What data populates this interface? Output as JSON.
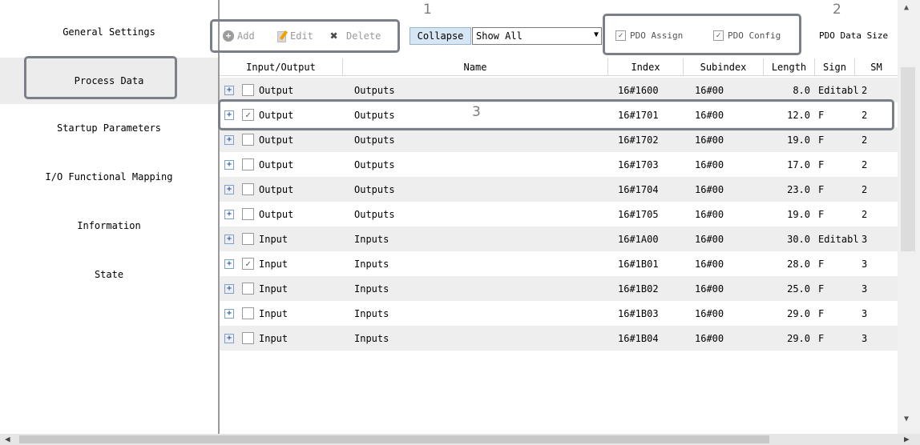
{
  "sidebar": {
    "items": [
      {
        "label": "General Settings"
      },
      {
        "label": "Process Data"
      },
      {
        "label": "Startup Parameters"
      },
      {
        "label": "I/O Functional Mapping"
      },
      {
        "label": "Information"
      },
      {
        "label": "State"
      }
    ]
  },
  "toolbar": {
    "add_label": "Add",
    "edit_label": "Edit",
    "delete_label": "Delete",
    "collapse_label": "Collapse",
    "filter_value": "Show All",
    "pdo_assign_label": "PDO Assign",
    "pdo_config_label": "PDO Config",
    "pdo_data_size_label": "PDO Data Size"
  },
  "annotations": {
    "one": "1",
    "two": "2",
    "three": "3"
  },
  "table": {
    "headers": [
      "Input/Output",
      "Name",
      "Index",
      "Subindex",
      "Length",
      "Sign",
      "SM"
    ],
    "rows": [
      {
        "io": "Output",
        "checked": false,
        "name": "Outputs",
        "index": "16#1600",
        "subindex": "16#00",
        "length": "8.0",
        "sign": "Editabl",
        "sm": "2"
      },
      {
        "io": "Output",
        "checked": true,
        "name": "Outputs",
        "index": "16#1701",
        "subindex": "16#00",
        "length": "12.0",
        "sign": "F",
        "sm": "2"
      },
      {
        "io": "Output",
        "checked": false,
        "name": "Outputs",
        "index": "16#1702",
        "subindex": "16#00",
        "length": "19.0",
        "sign": "F",
        "sm": "2"
      },
      {
        "io": "Output",
        "checked": false,
        "name": "Outputs",
        "index": "16#1703",
        "subindex": "16#00",
        "length": "17.0",
        "sign": "F",
        "sm": "2"
      },
      {
        "io": "Output",
        "checked": false,
        "name": "Outputs",
        "index": "16#1704",
        "subindex": "16#00",
        "length": "23.0",
        "sign": "F",
        "sm": "2"
      },
      {
        "io": "Output",
        "checked": false,
        "name": "Outputs",
        "index": "16#1705",
        "subindex": "16#00",
        "length": "19.0",
        "sign": "F",
        "sm": "2"
      },
      {
        "io": "Input",
        "checked": false,
        "name": "Inputs",
        "index": "16#1A00",
        "subindex": "16#00",
        "length": "30.0",
        "sign": "Editabl",
        "sm": "3"
      },
      {
        "io": "Input",
        "checked": true,
        "name": "Inputs",
        "index": "16#1B01",
        "subindex": "16#00",
        "length": "28.0",
        "sign": "F",
        "sm": "3"
      },
      {
        "io": "Input",
        "checked": false,
        "name": "Inputs",
        "index": "16#1B02",
        "subindex": "16#00",
        "length": "25.0",
        "sign": "F",
        "sm": "3"
      },
      {
        "io": "Input",
        "checked": false,
        "name": "Inputs",
        "index": "16#1B03",
        "subindex": "16#00",
        "length": "29.0",
        "sign": "F",
        "sm": "3"
      },
      {
        "io": "Input",
        "checked": false,
        "name": "Inputs",
        "index": "16#1B04",
        "subindex": "16#00",
        "length": "29.0",
        "sign": "F",
        "sm": "3"
      }
    ]
  },
  "icons": {
    "add": "add-circle-icon",
    "edit": "edit-icon",
    "delete": "delete-x-icon",
    "expand": "expand-plus-icon",
    "checkbox": "checkbox-icon"
  },
  "colors": {
    "highlight_border": "#7b8088",
    "collapse_button": "#d6e6f5",
    "row_alt": "#eeeeee",
    "sidebar_active": "#ececec"
  }
}
